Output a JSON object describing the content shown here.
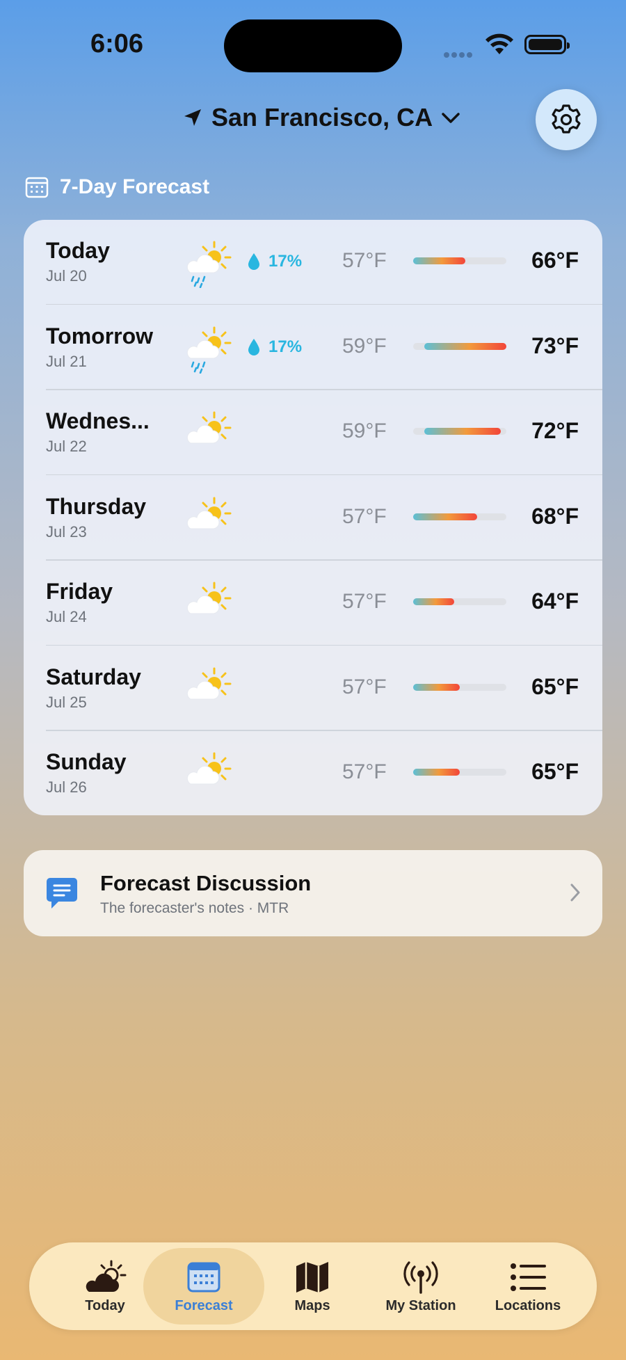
{
  "status_bar": {
    "time": "6:06"
  },
  "header": {
    "location": "San Francisco, CA"
  },
  "section": {
    "title": "7-Day Forecast"
  },
  "forecast": [
    {
      "day": "Today",
      "date": "Jul 20",
      "icon": "partly-sunny-rain-icon",
      "precip": "17%",
      "low": "57°F",
      "high": "66°F",
      "bar_start": 0.0,
      "bar_end": 0.56
    },
    {
      "day": "Tomorrow",
      "date": "Jul 21",
      "icon": "partly-sunny-rain-icon",
      "precip": "17%",
      "low": "59°F",
      "high": "73°F",
      "bar_start": 0.12,
      "bar_end": 1.0
    },
    {
      "day": "Wednes...",
      "date": "Jul 22",
      "icon": "partly-sunny-icon",
      "precip": "",
      "low": "59°F",
      "high": "72°F",
      "bar_start": 0.12,
      "bar_end": 0.94
    },
    {
      "day": "Thursday",
      "date": "Jul 23",
      "icon": "partly-sunny-icon",
      "precip": "",
      "low": "57°F",
      "high": "68°F",
      "bar_start": 0.0,
      "bar_end": 0.69
    },
    {
      "day": "Friday",
      "date": "Jul 24",
      "icon": "partly-sunny-icon",
      "precip": "",
      "low": "57°F",
      "high": "64°F",
      "bar_start": 0.0,
      "bar_end": 0.44
    },
    {
      "day": "Saturday",
      "date": "Jul 25",
      "icon": "partly-sunny-icon",
      "precip": "",
      "low": "57°F",
      "high": "65°F",
      "bar_start": 0.0,
      "bar_end": 0.5
    },
    {
      "day": "Sunday",
      "date": "Jul 26",
      "icon": "partly-sunny-icon",
      "precip": "",
      "low": "57°F",
      "high": "65°F",
      "bar_start": 0.0,
      "bar_end": 0.5
    }
  ],
  "discussion": {
    "title": "Forecast Discussion",
    "subtitle": "The forecaster's notes · MTR"
  },
  "tabs": [
    {
      "label": "Today",
      "icon": "cloud-sun-icon",
      "active": false
    },
    {
      "label": "Forecast",
      "icon": "calendar-icon",
      "active": true
    },
    {
      "label": "Maps",
      "icon": "map-icon",
      "active": false
    },
    {
      "label": "My Station",
      "icon": "antenna-icon",
      "active": false
    },
    {
      "label": "Locations",
      "icon": "list-icon",
      "active": false
    }
  ],
  "colors": {
    "accent": "#3b7fd6",
    "precip": "#29b6e0"
  }
}
